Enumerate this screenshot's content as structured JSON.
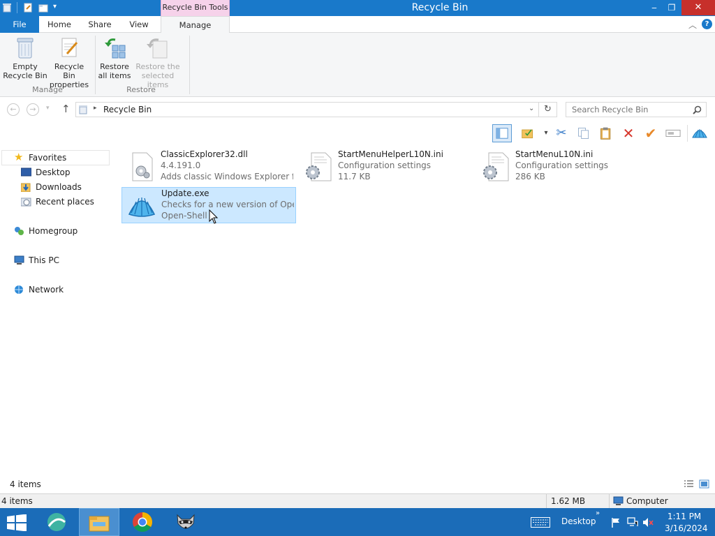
{
  "window": {
    "title": "Recycle Bin",
    "contextual_tab_title": "Recycle Bin Tools"
  },
  "tabs": {
    "file": "File",
    "home": "Home",
    "share": "Share",
    "view": "View",
    "manage": "Manage"
  },
  "ribbon": {
    "empty_label1": "Empty",
    "empty_label2": "Recycle Bin",
    "properties_label1": "Recycle Bin",
    "properties_label2": "properties",
    "restore_all_label1": "Restore",
    "restore_all_label2": "all items",
    "restore_selected_label1": "Restore the",
    "restore_selected_label2": "selected items",
    "group_manage": "Manage",
    "group_restore": "Restore"
  },
  "address": {
    "path": "Recycle Bin",
    "search_placeholder": "Search Recycle Bin"
  },
  "nav": {
    "favorites": "Favorites",
    "desktop": "Desktop",
    "downloads": "Downloads",
    "recent": "Recent places",
    "homegroup": "Homegroup",
    "thispc": "This PC",
    "network": "Network"
  },
  "files": [
    {
      "name": "ClassicExplorer32.dll",
      "line2": "4.4.191.0",
      "line3": "Adds classic Windows Explorer fe..."
    },
    {
      "name": "StartMenuHelperL10N.ini",
      "line2": "Configuration settings",
      "line3": "11.7 KB"
    },
    {
      "name": "StartMenuL10N.ini",
      "line2": "Configuration settings",
      "line3": "286 KB"
    },
    {
      "name": "Update.exe",
      "line2": "Checks for a new version of Open...",
      "line3": "Open-Shell"
    }
  ],
  "status": {
    "items_top": "4 items",
    "items_bottom": "4 items",
    "size": "1.62 MB",
    "location": "Computer"
  },
  "taskbar": {
    "desktop_label": "Desktop",
    "time": "1:11 PM",
    "date": "3/16/2024"
  },
  "colors": {
    "titlebar": "#1979ca",
    "taskbar": "#1b6cb8",
    "selection": "#cce8ff",
    "close": "#c7302b"
  }
}
